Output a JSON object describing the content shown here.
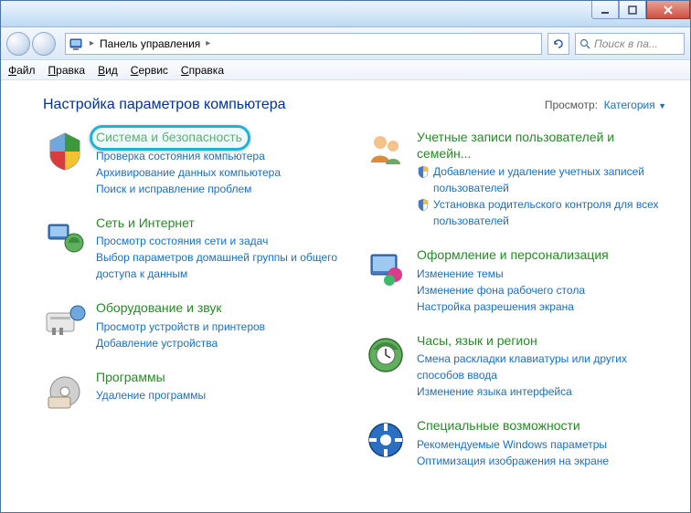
{
  "breadcrumb": {
    "label": "Панель управления",
    "arrow": "▸"
  },
  "search": {
    "placeholder": "Поиск в па..."
  },
  "menubar": [
    "Файл",
    "Правка",
    "Вид",
    "Сервис",
    "Справка"
  ],
  "page_title": "Настройка параметров компьютера",
  "viewby": {
    "label": "Просмотр:",
    "value": "Категория"
  },
  "highlight_target": "cat-system-security",
  "categories_left": [
    {
      "id": "system-security",
      "title": "Система и безопасность",
      "links": [
        {
          "text": "Проверка состояния компьютера",
          "shield": false
        },
        {
          "text": "Архивирование данных компьютера",
          "shield": false
        },
        {
          "text": "Поиск и исправление проблем",
          "shield": false
        }
      ]
    },
    {
      "id": "network",
      "title": "Сеть и Интернет",
      "links": [
        {
          "text": "Просмотр состояния сети и задач",
          "shield": false
        },
        {
          "text": "Выбор параметров домашней группы и общего доступа к данным",
          "shield": false
        }
      ]
    },
    {
      "id": "hardware",
      "title": "Оборудование и звук",
      "links": [
        {
          "text": "Просмотр устройств и принтеров",
          "shield": false
        },
        {
          "text": "Добавление устройства",
          "shield": false
        }
      ]
    },
    {
      "id": "programs",
      "title": "Программы",
      "links": [
        {
          "text": "Удаление программы",
          "shield": false
        }
      ]
    }
  ],
  "categories_right": [
    {
      "id": "users",
      "title": "Учетные записи пользователей и семейн...",
      "links": [
        {
          "text": "Добавление и удаление учетных записей пользователей",
          "shield": true
        },
        {
          "text": "Установка родительского контроля для всех пользователей",
          "shield": true
        }
      ]
    },
    {
      "id": "appearance",
      "title": "Оформление и персонализация",
      "links": [
        {
          "text": "Изменение темы",
          "shield": false
        },
        {
          "text": "Изменение фона рабочего стола",
          "shield": false
        },
        {
          "text": "Настройка разрешения экрана",
          "shield": false
        }
      ]
    },
    {
      "id": "clock",
      "title": "Часы, язык и регион",
      "links": [
        {
          "text": "Смена раскладки клавиатуры или других способов ввода",
          "shield": false
        },
        {
          "text": "Изменение языка интерфейса",
          "shield": false
        }
      ]
    },
    {
      "id": "accessibility",
      "title": "Специальные возможности",
      "links": [
        {
          "text": "Рекомендуемые Windows параметры",
          "shield": false
        },
        {
          "text": "Оптимизация изображения на экране",
          "shield": false
        }
      ]
    }
  ]
}
